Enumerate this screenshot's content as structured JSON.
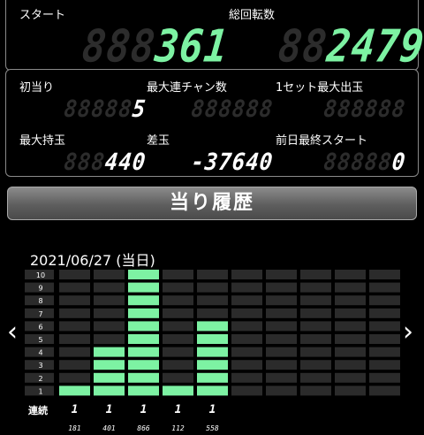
{
  "stats": {
    "start_label": "スタート",
    "start_ghost": "888",
    "start_value": "361",
    "total_label": "総回転数",
    "total_ghost": "88",
    "total_value": "2479",
    "hits_label": "初当り",
    "hits_ghost": "88888",
    "hits_value": "5",
    "maxrun_label": "最大連チャン数",
    "maxrun_ghost": "888888",
    "maxrun_value": "",
    "maxset_label": "1セット最大出玉",
    "maxset_ghost": "888888",
    "maxset_value": "",
    "maxhold_label": "最大持玉",
    "maxhold_ghost": "888",
    "maxhold_value": "440",
    "diff_label": "差玉",
    "diff_ghost": "",
    "diff_value": "-37640",
    "prevstart_label": "前日最終スタート",
    "prevstart_ghost": "88888",
    "prevstart_value": "0"
  },
  "history": {
    "header": "当り履歴",
    "date": "2021/06/27 (当日)",
    "prev_arrow": "‹",
    "next_arrow": "›",
    "row_label": "連続",
    "levels": [
      "1",
      "2",
      "3",
      "4",
      "5",
      "6",
      "7",
      "8",
      "9",
      "10"
    ],
    "columns": [
      {
        "runs": 1,
        "run_label": "1",
        "start": "181"
      },
      {
        "runs": 4,
        "run_label": "1",
        "start": "401"
      },
      {
        "runs": 10,
        "run_label": "1",
        "start": "866"
      },
      {
        "runs": 1,
        "run_label": "1",
        "start": "112"
      },
      {
        "runs": 6,
        "run_label": "1",
        "start": "558"
      },
      {
        "runs": 0,
        "run_label": "",
        "start": ""
      },
      {
        "runs": 0,
        "run_label": "",
        "start": ""
      },
      {
        "runs": 0,
        "run_label": "",
        "start": ""
      },
      {
        "runs": 0,
        "run_label": "",
        "start": ""
      },
      {
        "runs": 0,
        "run_label": "",
        "start": ""
      }
    ],
    "empty_color": "#2b2b2b",
    "bar_color": "#7df2a3"
  }
}
